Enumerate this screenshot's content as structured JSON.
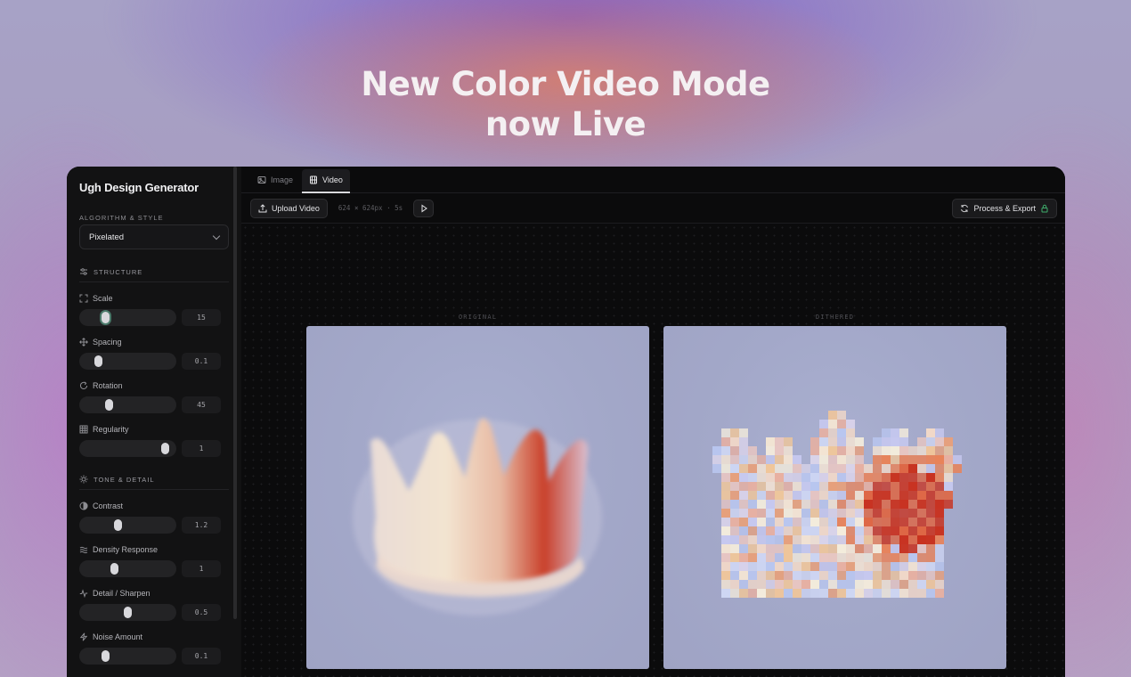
{
  "headline": {
    "line1": "New Color Video Mode",
    "line2": "now Live"
  },
  "sidebar": {
    "title": "Ugh Design Generator",
    "algorithm_label": "ALGORITHM & STYLE",
    "algorithm_value": "Pixelated",
    "structure": {
      "label": "STRUCTURE",
      "controls": [
        {
          "label": "Scale",
          "value": "15",
          "level": 0.23,
          "icon": "expand-icon"
        },
        {
          "label": "Spacing",
          "value": "0.1",
          "level": 0.14,
          "icon": "move-icon"
        },
        {
          "label": "Rotation",
          "value": "45",
          "level": 0.27,
          "icon": "rotate-icon"
        },
        {
          "label": "Regularity",
          "value": "1",
          "level": 0.96,
          "icon": "grid-icon"
        }
      ]
    },
    "tone": {
      "label": "TONE & DETAIL",
      "controls": [
        {
          "label": "Contrast",
          "value": "1.2",
          "level": 0.38,
          "icon": "contrast-icon"
        },
        {
          "label": "Density Response",
          "value": "1",
          "level": 0.33,
          "icon": "waves-icon"
        },
        {
          "label": "Detail / Sharpen",
          "value": "0.5",
          "level": 0.5,
          "icon": "pulse-icon"
        },
        {
          "label": "Noise Amount",
          "value": "0.1",
          "level": 0.22,
          "icon": "zap-icon"
        }
      ]
    }
  },
  "tabs": [
    {
      "label": "Image",
      "icon": "image-icon",
      "active": false
    },
    {
      "label": "Video",
      "icon": "film-icon",
      "active": true
    }
  ],
  "toolbar": {
    "upload_label": "Upload Video",
    "meta": "624 × 624px · 5s",
    "export_label": "Process & Export"
  },
  "preview": {
    "original_label": "ORIGINAL",
    "dithered_label": "DITHERED"
  }
}
